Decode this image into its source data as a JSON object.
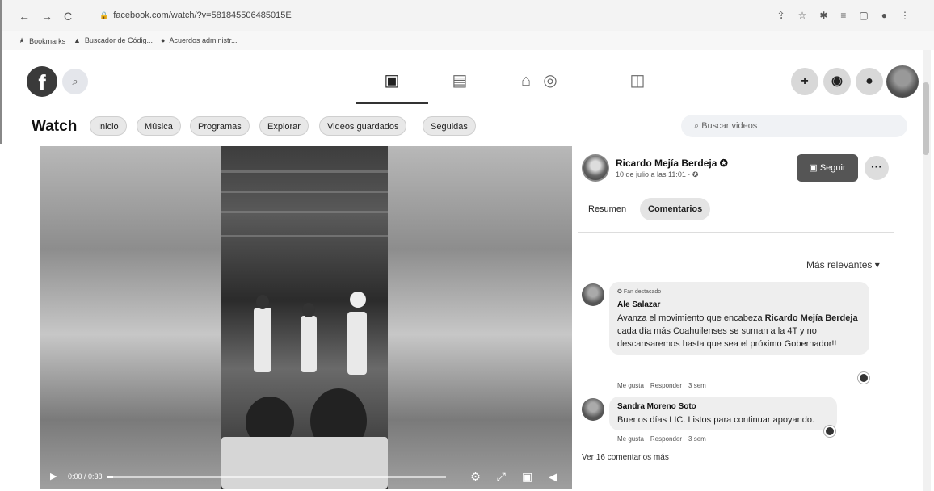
{
  "browser": {
    "url": "facebook.com/watch/?v=581845506485015E",
    "bookmarks": [
      {
        "label": "Bookmarks",
        "icon": "star-icon"
      },
      {
        "label": "Buscador de Códig...",
        "icon": "folder-icon"
      },
      {
        "label": "Acuerdos administr...",
        "icon": "site-icon"
      }
    ]
  },
  "header": {
    "search_icon": "search-icon",
    "nav": [
      "home-icon",
      "watch-icon",
      "marketplace-icon",
      "groups-icon",
      "gaming-icon"
    ],
    "actions": [
      "+",
      "messenger",
      "notifications"
    ]
  },
  "watch": {
    "title": "Watch",
    "pills": [
      "Inicio",
      "Música",
      "Programas",
      "Explorar",
      "Videos guardados",
      "Seguidas"
    ],
    "search_placeholder": "Buscar videos"
  },
  "video": {
    "time": "0:00 / 0:38",
    "progress": 0.02
  },
  "post": {
    "author": "Ricardo Mejía Berdeja",
    "date": "10 de julio a las 11:01 · ",
    "follow_label": "Seguir",
    "more_label": "···",
    "tabs": [
      "Resumen",
      "Comentarios"
    ],
    "sort_label": "Más relevantes ▾"
  },
  "comments": [
    {
      "badge": "Fan destacado",
      "name": "Ale Salazar",
      "text_prefix": "Avanza el movimiento que encabeza ",
      "text_bold": "Ricardo Mejía Berdeja",
      "text_suffix": " cada día más Coahuilenses se suman a la 4T y no descansaremos hasta que sea el próximo Gobernador!!",
      "like": "Me gusta",
      "reply": "Responder",
      "age": "3 sem"
    },
    {
      "name": "Sandra Moreno Soto",
      "text": "Buenos días LIC. Listos para continuar apoyando.",
      "like": "Me gusta",
      "reply": "Responder",
      "age": "3 sem"
    }
  ],
  "more_comments": "Ver 16 comentarios más"
}
